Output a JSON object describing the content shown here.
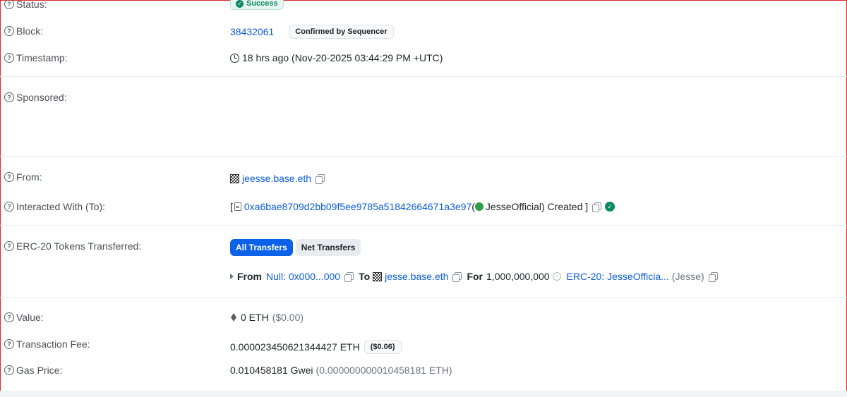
{
  "status": {
    "label": "Status:",
    "value": "Success"
  },
  "block": {
    "label": "Block:",
    "number": "38432061",
    "badge": "Confirmed by Sequencer"
  },
  "timestamp": {
    "label": "Timestamp:",
    "value": "18 hrs ago (Nov-20-2025 03:44:29 PM +UTC)"
  },
  "sponsored": {
    "label": "Sponsored:"
  },
  "from": {
    "label": "From:",
    "name": "jeesse.base.eth"
  },
  "interacted": {
    "label": "Interacted With (To):",
    "open": "[",
    "address": "0xa6bae8709d2bb09f5ee9785a51842664671a3e97",
    "paren_open": "(",
    "token_name": "JesseOfficial",
    "suffix": ") Created ]"
  },
  "erc20": {
    "label": "ERC-20 Tokens Transferred:",
    "tabs": [
      "All Transfers",
      "Net Transfers"
    ],
    "transfer": {
      "from_label": "From",
      "from_value": "Null: 0x000...000",
      "to_label": "To",
      "to_value": "jesse.base.eth",
      "for_label": "For",
      "amount": "1,000,000,000",
      "token": "ERC-20: JesseOfficia...",
      "symbol": "(Jesse)"
    }
  },
  "value": {
    "label": "Value:",
    "amount": "0 ETH",
    "usd": "($0.00)"
  },
  "fee": {
    "label": "Transaction Fee:",
    "amount": "0.000023450621344427 ETH",
    "usd": "($0.06)"
  },
  "gas": {
    "label": "Gas Price:",
    "gwei": "0.010458181 Gwei",
    "eth": "(0.000000000010458181 ETH)"
  },
  "colors": {
    "link": "#0a5cd8",
    "success": "#0b8a61",
    "active_tab": "#0b61e8"
  },
  "icons": {
    "help": "question-circle-icon",
    "clock": "clock-icon",
    "copy": "copy-icon",
    "eth": "ethereum-icon"
  }
}
